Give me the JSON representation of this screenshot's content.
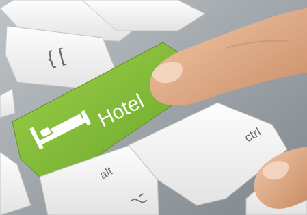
{
  "scene": {
    "subject": "keyboard",
    "hotel_key": {
      "label": "Hotel",
      "icon": "bed-icon",
      "color": "#8cc63f"
    },
    "ctrl_key": {
      "label": "ctrl"
    },
    "alt_key": {
      "label": "alt"
    },
    "shift_key_glyph": {
      "label": "⌥"
    },
    "bracket_key": {
      "label": "{ ["
    }
  },
  "colors": {
    "keyboard_base": "#9aa0a5",
    "key_face": "#f4f4f4",
    "accent": "#8cc63f",
    "skin": "#e8b693"
  }
}
